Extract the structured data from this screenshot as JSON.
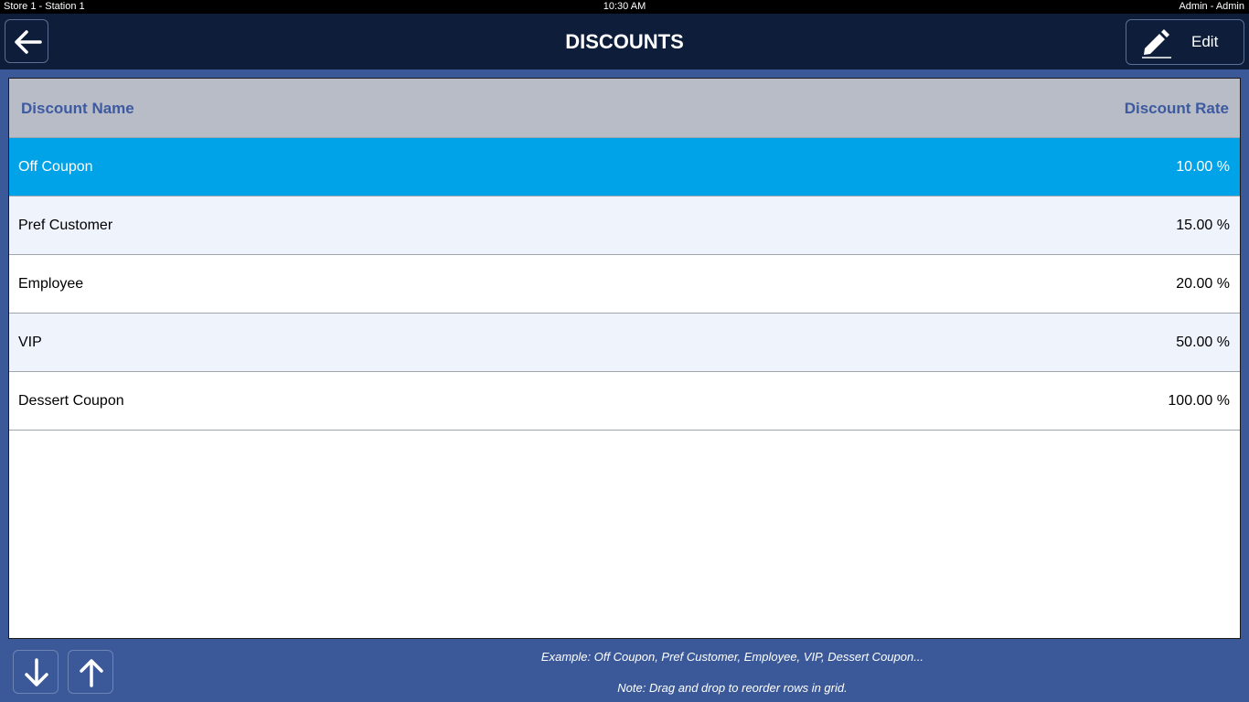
{
  "status_bar": {
    "left": "Store 1 - Station 1",
    "time": "10:30 AM",
    "user": "Admin - Admin"
  },
  "header": {
    "title": "DISCOUNTS",
    "back_icon": "arrow-left-icon",
    "edit_label": "Edit",
    "edit_icon": "pencil-icon"
  },
  "grid": {
    "columns": [
      "Discount Name",
      "Discount Rate"
    ],
    "rows": [
      {
        "name": "Off Coupon",
        "rate": "10.00 %",
        "selected": true
      },
      {
        "name": "Pref Customer",
        "rate": "15.00 %",
        "selected": false
      },
      {
        "name": "Employee",
        "rate": "20.00 %",
        "selected": false
      },
      {
        "name": "VIP",
        "rate": "50.00 %",
        "selected": false
      },
      {
        "name": "Dessert Coupon",
        "rate": "100.00 %",
        "selected": false
      }
    ]
  },
  "footer": {
    "move_down_icon": "arrow-down-icon",
    "move_up_icon": "arrow-up-icon",
    "example": "Example: Off Coupon, Pref Customer, Employee, VIP, Dessert Coupon...",
    "note": "Note: Drag and drop to reorder rows in grid."
  },
  "colors": {
    "background": "#3b5998",
    "title_bar": "#0e1e3a",
    "header_row": "#b8bcc6",
    "header_text": "#3d5aa0",
    "selected_row": "#00a2e8",
    "alt_row": "#eef3fc"
  }
}
